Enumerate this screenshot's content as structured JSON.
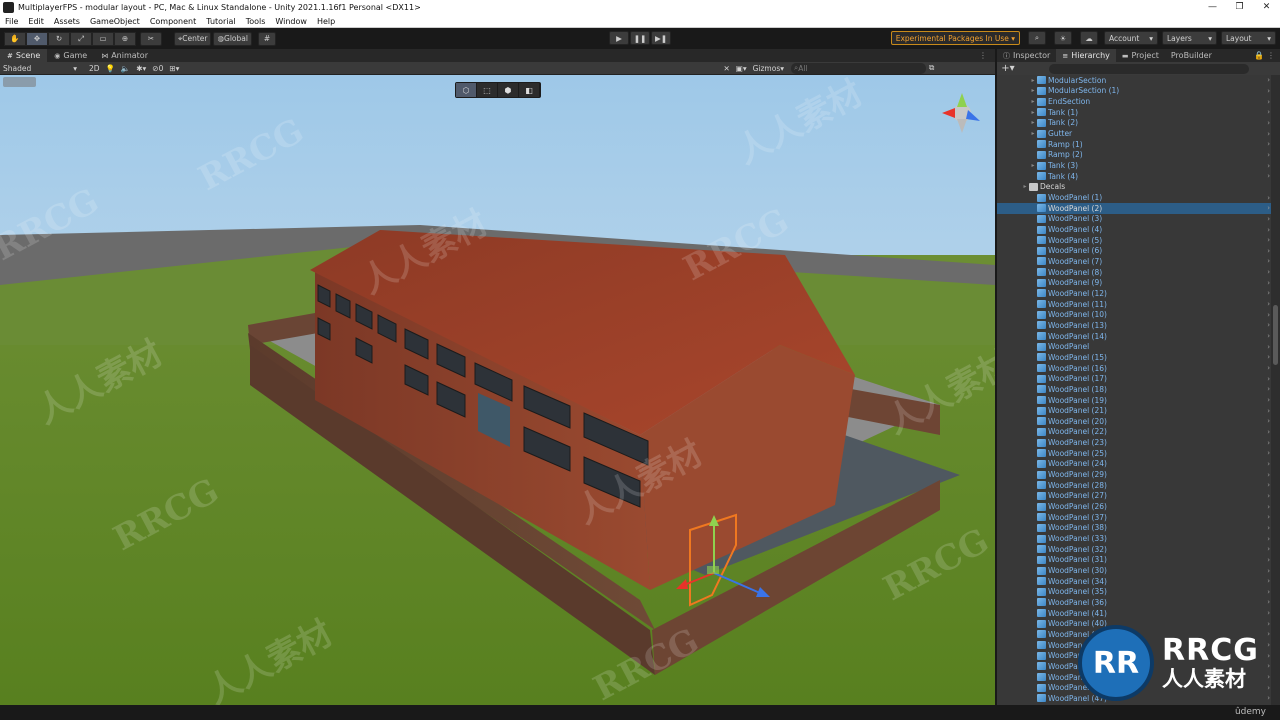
{
  "window": {
    "title": "MultiplayerFPS - modular layout - PC, Mac & Linux Standalone - Unity 2021.1.16f1 Personal <DX11>",
    "controls": [
      "—",
      "❐",
      "✕"
    ]
  },
  "menu": [
    "File",
    "Edit",
    "Assets",
    "GameObject",
    "Component",
    "Tutorial",
    "Tools",
    "Window",
    "Help"
  ],
  "toolbar": {
    "pivot": "Center",
    "space": "Global",
    "experimental": "Experimental Packages In Use ▾",
    "account": "Account",
    "layers": "Layers",
    "layout": "Layout"
  },
  "scene_tabs": [
    {
      "label": "Scene",
      "icon": "#"
    },
    {
      "label": "Game",
      "icon": "◉"
    },
    {
      "label": "Animator",
      "icon": "⋈"
    }
  ],
  "scene_toolbar": {
    "draw_mode": "Shaded",
    "mode_2d": "2D",
    "hidden_count": "0",
    "gizmos": "Gizmos",
    "search_placeholder": "All"
  },
  "right_tabs": [
    {
      "label": "Inspector",
      "icon": "ⓘ"
    },
    {
      "label": "Hierarchy",
      "icon": "≡"
    },
    {
      "label": "Project",
      "icon": "▬"
    },
    {
      "label": "ProBuilder",
      "icon": ""
    }
  ],
  "hierarchy": {
    "items": [
      {
        "name": "ModularSection",
        "kind": "prefab",
        "fold": "▸",
        "white": false
      },
      {
        "name": "ModularSection (1)",
        "kind": "prefab",
        "fold": "▸",
        "white": false
      },
      {
        "name": "EndSection",
        "kind": "prefab",
        "fold": "▸",
        "white": false
      },
      {
        "name": "Tank (1)",
        "kind": "prefab",
        "fold": "▸",
        "white": false
      },
      {
        "name": "Tank (2)",
        "kind": "prefab",
        "fold": "▸",
        "white": false
      },
      {
        "name": "Gutter",
        "kind": "prefab",
        "fold": "▸",
        "white": false
      },
      {
        "name": "Ramp (1)",
        "kind": "prefab",
        "fold": "",
        "white": false
      },
      {
        "name": "Ramp (2)",
        "kind": "prefab",
        "fold": "",
        "white": false
      },
      {
        "name": "Tank (3)",
        "kind": "prefab",
        "fold": "▸",
        "white": false
      },
      {
        "name": "Tank (4)",
        "kind": "prefab",
        "fold": "",
        "white": false
      },
      {
        "name": "Decals",
        "kind": "object",
        "fold": "▸",
        "white": true
      },
      {
        "name": "WoodPanel (1)",
        "kind": "prefab",
        "fold": "",
        "white": false
      },
      {
        "name": "WoodPanel (2)",
        "kind": "prefab",
        "fold": "",
        "white": true,
        "selected": true
      },
      {
        "name": "WoodPanel (3)",
        "kind": "prefab",
        "fold": "",
        "white": false
      },
      {
        "name": "WoodPanel (4)",
        "kind": "prefab",
        "fold": "",
        "white": false
      },
      {
        "name": "WoodPanel (5)",
        "kind": "prefab",
        "fold": "",
        "white": false
      },
      {
        "name": "WoodPanel (6)",
        "kind": "prefab",
        "fold": "",
        "white": false
      },
      {
        "name": "WoodPanel (7)",
        "kind": "prefab",
        "fold": "",
        "white": false
      },
      {
        "name": "WoodPanel (8)",
        "kind": "prefab",
        "fold": "",
        "white": false
      },
      {
        "name": "WoodPanel (9)",
        "kind": "prefab",
        "fold": "",
        "white": false
      },
      {
        "name": "WoodPanel (12)",
        "kind": "prefab",
        "fold": "",
        "white": false
      },
      {
        "name": "WoodPanel (11)",
        "kind": "prefab",
        "fold": "",
        "white": false
      },
      {
        "name": "WoodPanel (10)",
        "kind": "prefab",
        "fold": "",
        "white": false
      },
      {
        "name": "WoodPanel (13)",
        "kind": "prefab",
        "fold": "",
        "white": false
      },
      {
        "name": "WoodPanel (14)",
        "kind": "prefab",
        "fold": "",
        "white": false
      },
      {
        "name": "WoodPanel",
        "kind": "prefab",
        "fold": "",
        "white": false
      },
      {
        "name": "WoodPanel (15)",
        "kind": "prefab",
        "fold": "",
        "white": false
      },
      {
        "name": "WoodPanel (16)",
        "kind": "prefab",
        "fold": "",
        "white": false
      },
      {
        "name": "WoodPanel (17)",
        "kind": "prefab",
        "fold": "",
        "white": false
      },
      {
        "name": "WoodPanel (18)",
        "kind": "prefab",
        "fold": "",
        "white": false
      },
      {
        "name": "WoodPanel (19)",
        "kind": "prefab",
        "fold": "",
        "white": false
      },
      {
        "name": "WoodPanel (21)",
        "kind": "prefab",
        "fold": "",
        "white": false
      },
      {
        "name": "WoodPanel (20)",
        "kind": "prefab",
        "fold": "",
        "white": false
      },
      {
        "name": "WoodPanel (22)",
        "kind": "prefab",
        "fold": "",
        "white": false
      },
      {
        "name": "WoodPanel (23)",
        "kind": "prefab",
        "fold": "",
        "white": false
      },
      {
        "name": "WoodPanel (25)",
        "kind": "prefab",
        "fold": "",
        "white": false
      },
      {
        "name": "WoodPanel (24)",
        "kind": "prefab",
        "fold": "",
        "white": false
      },
      {
        "name": "WoodPanel (29)",
        "kind": "prefab",
        "fold": "",
        "white": false
      },
      {
        "name": "WoodPanel (28)",
        "kind": "prefab",
        "fold": "",
        "white": false
      },
      {
        "name": "WoodPanel (27)",
        "kind": "prefab",
        "fold": "",
        "white": false
      },
      {
        "name": "WoodPanel (26)",
        "kind": "prefab",
        "fold": "",
        "white": false
      },
      {
        "name": "WoodPanel (37)",
        "kind": "prefab",
        "fold": "",
        "white": false
      },
      {
        "name": "WoodPanel (38)",
        "kind": "prefab",
        "fold": "",
        "white": false
      },
      {
        "name": "WoodPanel (33)",
        "kind": "prefab",
        "fold": "",
        "white": false
      },
      {
        "name": "WoodPanel (32)",
        "kind": "prefab",
        "fold": "",
        "white": false
      },
      {
        "name": "WoodPanel (31)",
        "kind": "prefab",
        "fold": "",
        "white": false
      },
      {
        "name": "WoodPanel (30)",
        "kind": "prefab",
        "fold": "",
        "white": false
      },
      {
        "name": "WoodPanel (34)",
        "kind": "prefab",
        "fold": "",
        "white": false
      },
      {
        "name": "WoodPanel (35)",
        "kind": "prefab",
        "fold": "",
        "white": false
      },
      {
        "name": "WoodPanel (36)",
        "kind": "prefab",
        "fold": "",
        "white": false
      },
      {
        "name": "WoodPanel (41)",
        "kind": "prefab",
        "fold": "",
        "white": false
      },
      {
        "name": "WoodPanel (40)",
        "kind": "prefab",
        "fold": "",
        "white": false
      },
      {
        "name": "WoodPanel (39)",
        "kind": "prefab",
        "fold": "",
        "white": false
      },
      {
        "name": "WoodPanel (42)",
        "kind": "prefab",
        "fold": "",
        "white": false
      },
      {
        "name": "WoodPanel (43)",
        "kind": "prefab",
        "fold": "",
        "white": false
      },
      {
        "name": "WoodPanel (44)",
        "kind": "prefab",
        "fold": "",
        "white": false
      },
      {
        "name": "WoodPanel (45)",
        "kind": "prefab",
        "fold": "",
        "white": false
      },
      {
        "name": "WoodPanel (46)",
        "kind": "prefab",
        "fold": "",
        "white": false
      },
      {
        "name": "WoodPanel (47)",
        "kind": "prefab",
        "fold": "",
        "white": false
      },
      {
        "name": "WoodPanel (48)",
        "kind": "prefab",
        "fold": "",
        "white": false
      }
    ]
  },
  "watermark": {
    "latin": "RRCG",
    "cjk": "人人素材"
  },
  "brand": {
    "logo": "RR",
    "name": "RRCG",
    "cn": "人人素材"
  },
  "footer": "ûdemy",
  "colors": {
    "selection": "#2c5d87",
    "prefab_text": "#7fb6ec",
    "experimental_accent": "#f0a030",
    "gizmo_x": "#e8332a",
    "gizmo_y": "#8fd14f",
    "gizmo_z": "#3a73e8",
    "selection_outline": "#f07820"
  }
}
